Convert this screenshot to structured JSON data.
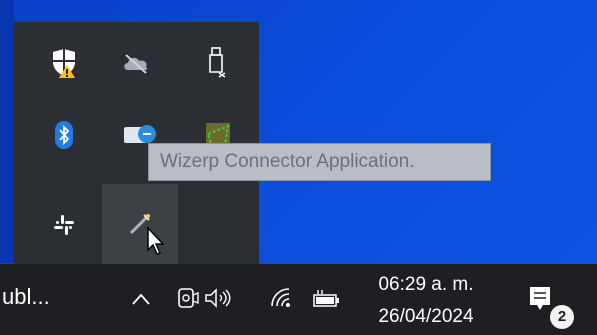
{
  "tray_flyout": {
    "icons": [
      {
        "name": "windows-security-warning-icon"
      },
      {
        "name": "onedrive-offline-icon"
      },
      {
        "name": "usb-eject-icon"
      },
      {
        "name": "bluetooth-icon"
      },
      {
        "name": "remote-desktop-icon"
      },
      {
        "name": "wizerp-app-icon"
      },
      {
        "name": "slack-icon"
      },
      {
        "name": "wizerp-connector-icon"
      }
    ],
    "tooltip": "Wizerp Connector Application."
  },
  "taskbar": {
    "task_label": "ubl...",
    "time": "06:29 a. m.",
    "date": "26/04/2024",
    "notification_count": "2"
  },
  "colors": {
    "desktop": "#0b4ad8",
    "flyout_bg": "#2b2f33",
    "taskbar_bg": "#1e1f22",
    "shield_yellow": "#f5c518"
  }
}
